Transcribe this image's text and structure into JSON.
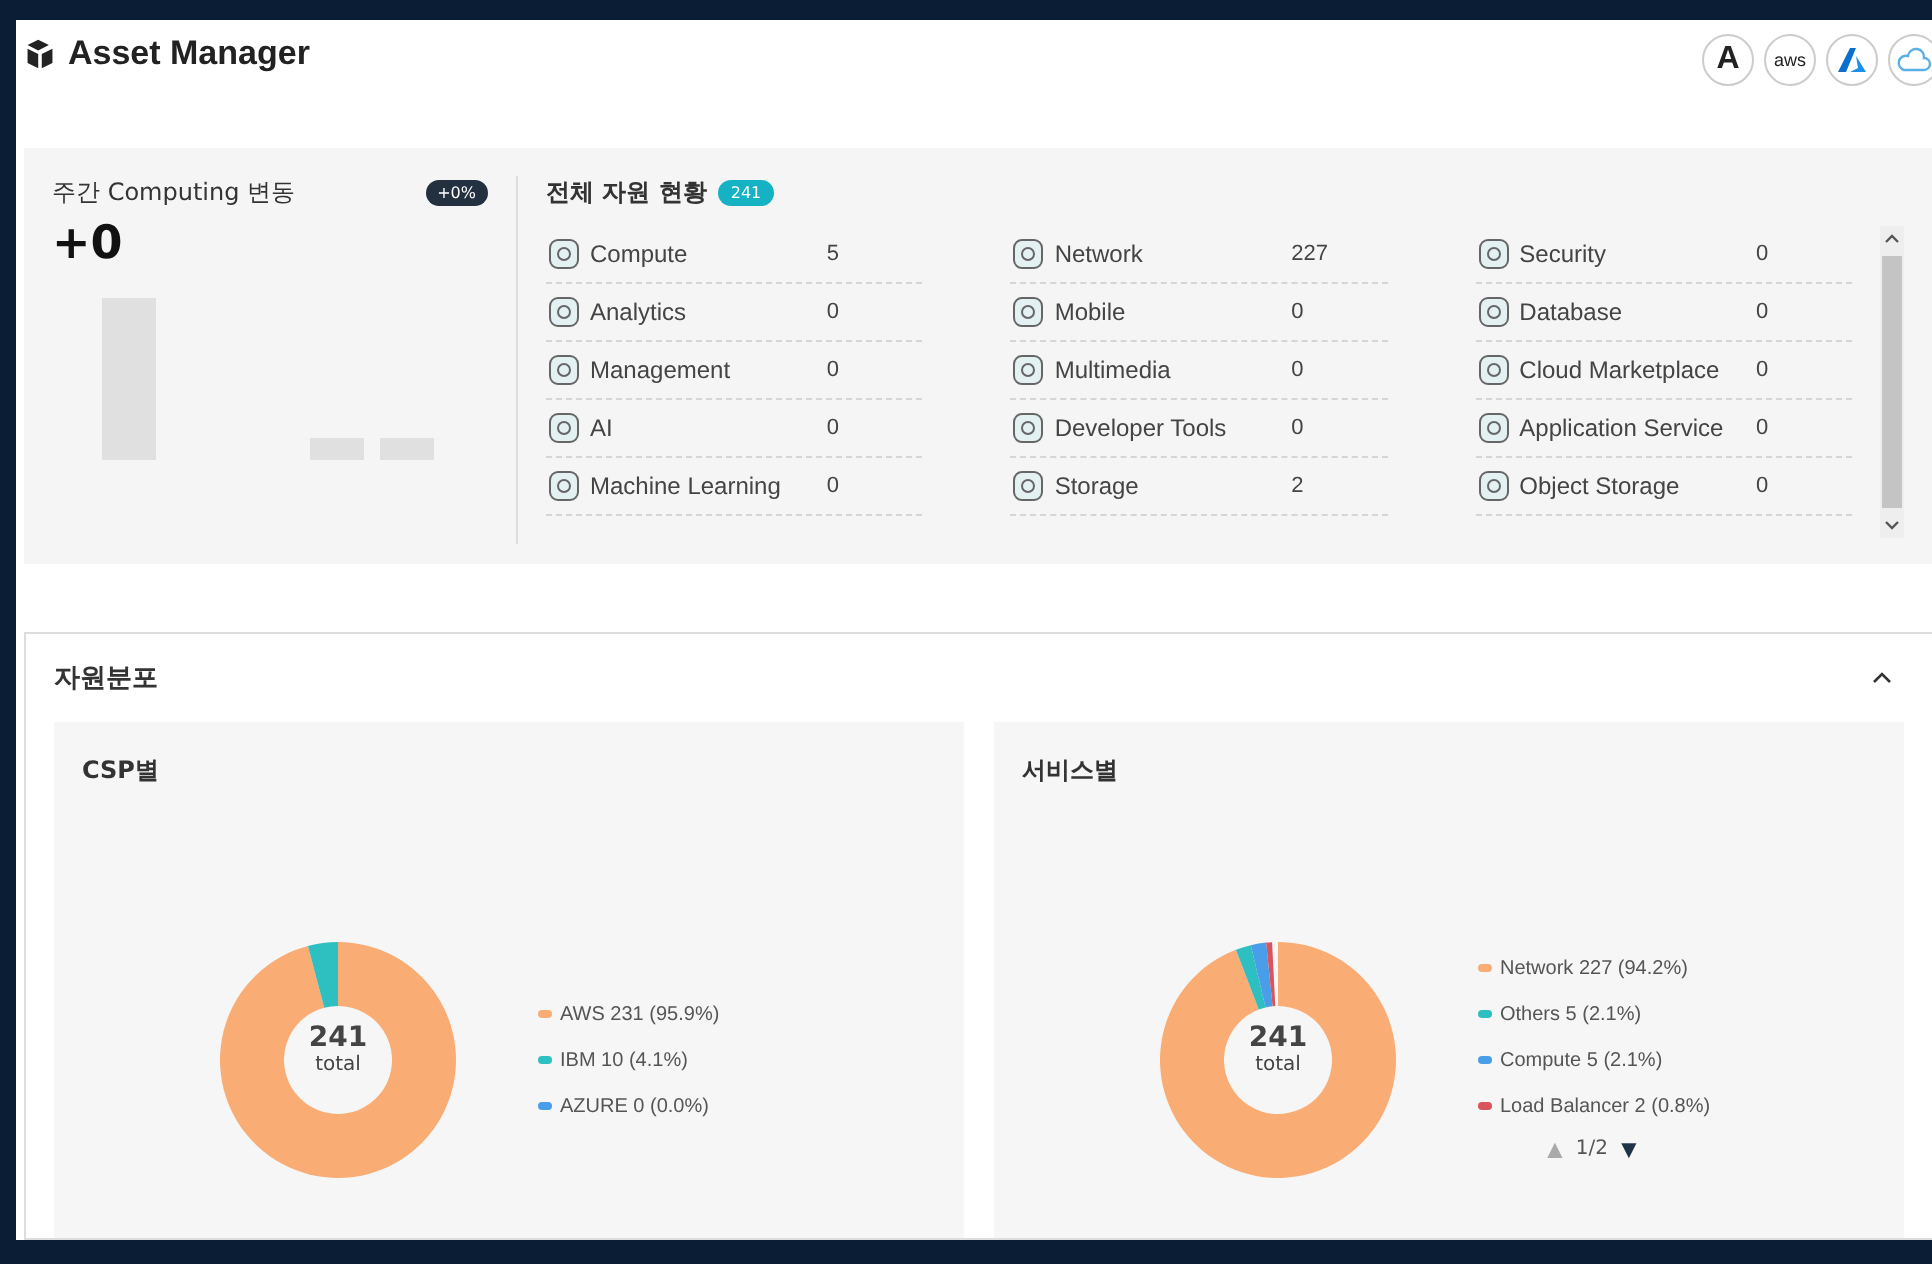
{
  "header": {
    "title": "Asset Manager",
    "providers": [
      {
        "kind": "letter",
        "label": "A"
      },
      {
        "kind": "aws",
        "label": "aws"
      },
      {
        "kind": "azure"
      },
      {
        "kind": "cloud"
      }
    ]
  },
  "weekly": {
    "title": "주간 Computing 변동",
    "badge": "+0%",
    "value": "+0"
  },
  "resources": {
    "title": "전체 자원 현황",
    "badge": "241",
    "columns": [
      [
        {
          "name": "Compute",
          "count": "5"
        },
        {
          "name": "Analytics",
          "count": "0"
        },
        {
          "name": "Management",
          "count": "0"
        },
        {
          "name": "AI",
          "count": "0"
        },
        {
          "name": "Machine Learning",
          "count": "0"
        }
      ],
      [
        {
          "name": "Network",
          "count": "227"
        },
        {
          "name": "Mobile",
          "count": "0"
        },
        {
          "name": "Multimedia",
          "count": "0"
        },
        {
          "name": "Developer Tools",
          "count": "0"
        },
        {
          "name": "Storage",
          "count": "2"
        }
      ],
      [
        {
          "name": "Security",
          "count": "0"
        },
        {
          "name": "Database",
          "count": "0"
        },
        {
          "name": "Cloud Marketplace",
          "count": "0"
        },
        {
          "name": "Application Service",
          "count": "0"
        },
        {
          "name": "Object Storage",
          "count": "0"
        }
      ]
    ]
  },
  "distribution": {
    "title": "자원분포",
    "expanded": true,
    "panels": [
      {
        "title": "CSP별",
        "center_value": "241",
        "center_label": "total",
        "legend": [
          {
            "label": "AWS 231 (95.9%)",
            "color": "#f9ad75"
          },
          {
            "label": "IBM 10 (4.1%)",
            "color": "#2ebfc0"
          },
          {
            "label": "AZURE 0 (0.0%)",
            "color": "#4a9de8"
          }
        ],
        "chart_data": {
          "type": "donut",
          "values": [
            95.9,
            4.1,
            0.0
          ]
        }
      },
      {
        "title": "서비스별",
        "center_value": "241",
        "center_label": "total",
        "legend": [
          {
            "label": "Network 227 (94.2%)",
            "color": "#f9ad75"
          },
          {
            "label": "Others 5 (2.1%)",
            "color": "#2ebfc0"
          },
          {
            "label": "Compute 5 (2.1%)",
            "color": "#4a9de8"
          },
          {
            "label": "Load Balancer 2 (0.8%)",
            "color": "#d9545c"
          }
        ],
        "pager": {
          "up": "▲",
          "page": "1/2",
          "down": "▼",
          "up_disabled": true,
          "down_disabled": false
        },
        "chart_data": {
          "type": "donut",
          "values": [
            94.2,
            2.1,
            2.1,
            0.8
          ]
        }
      }
    ]
  }
}
